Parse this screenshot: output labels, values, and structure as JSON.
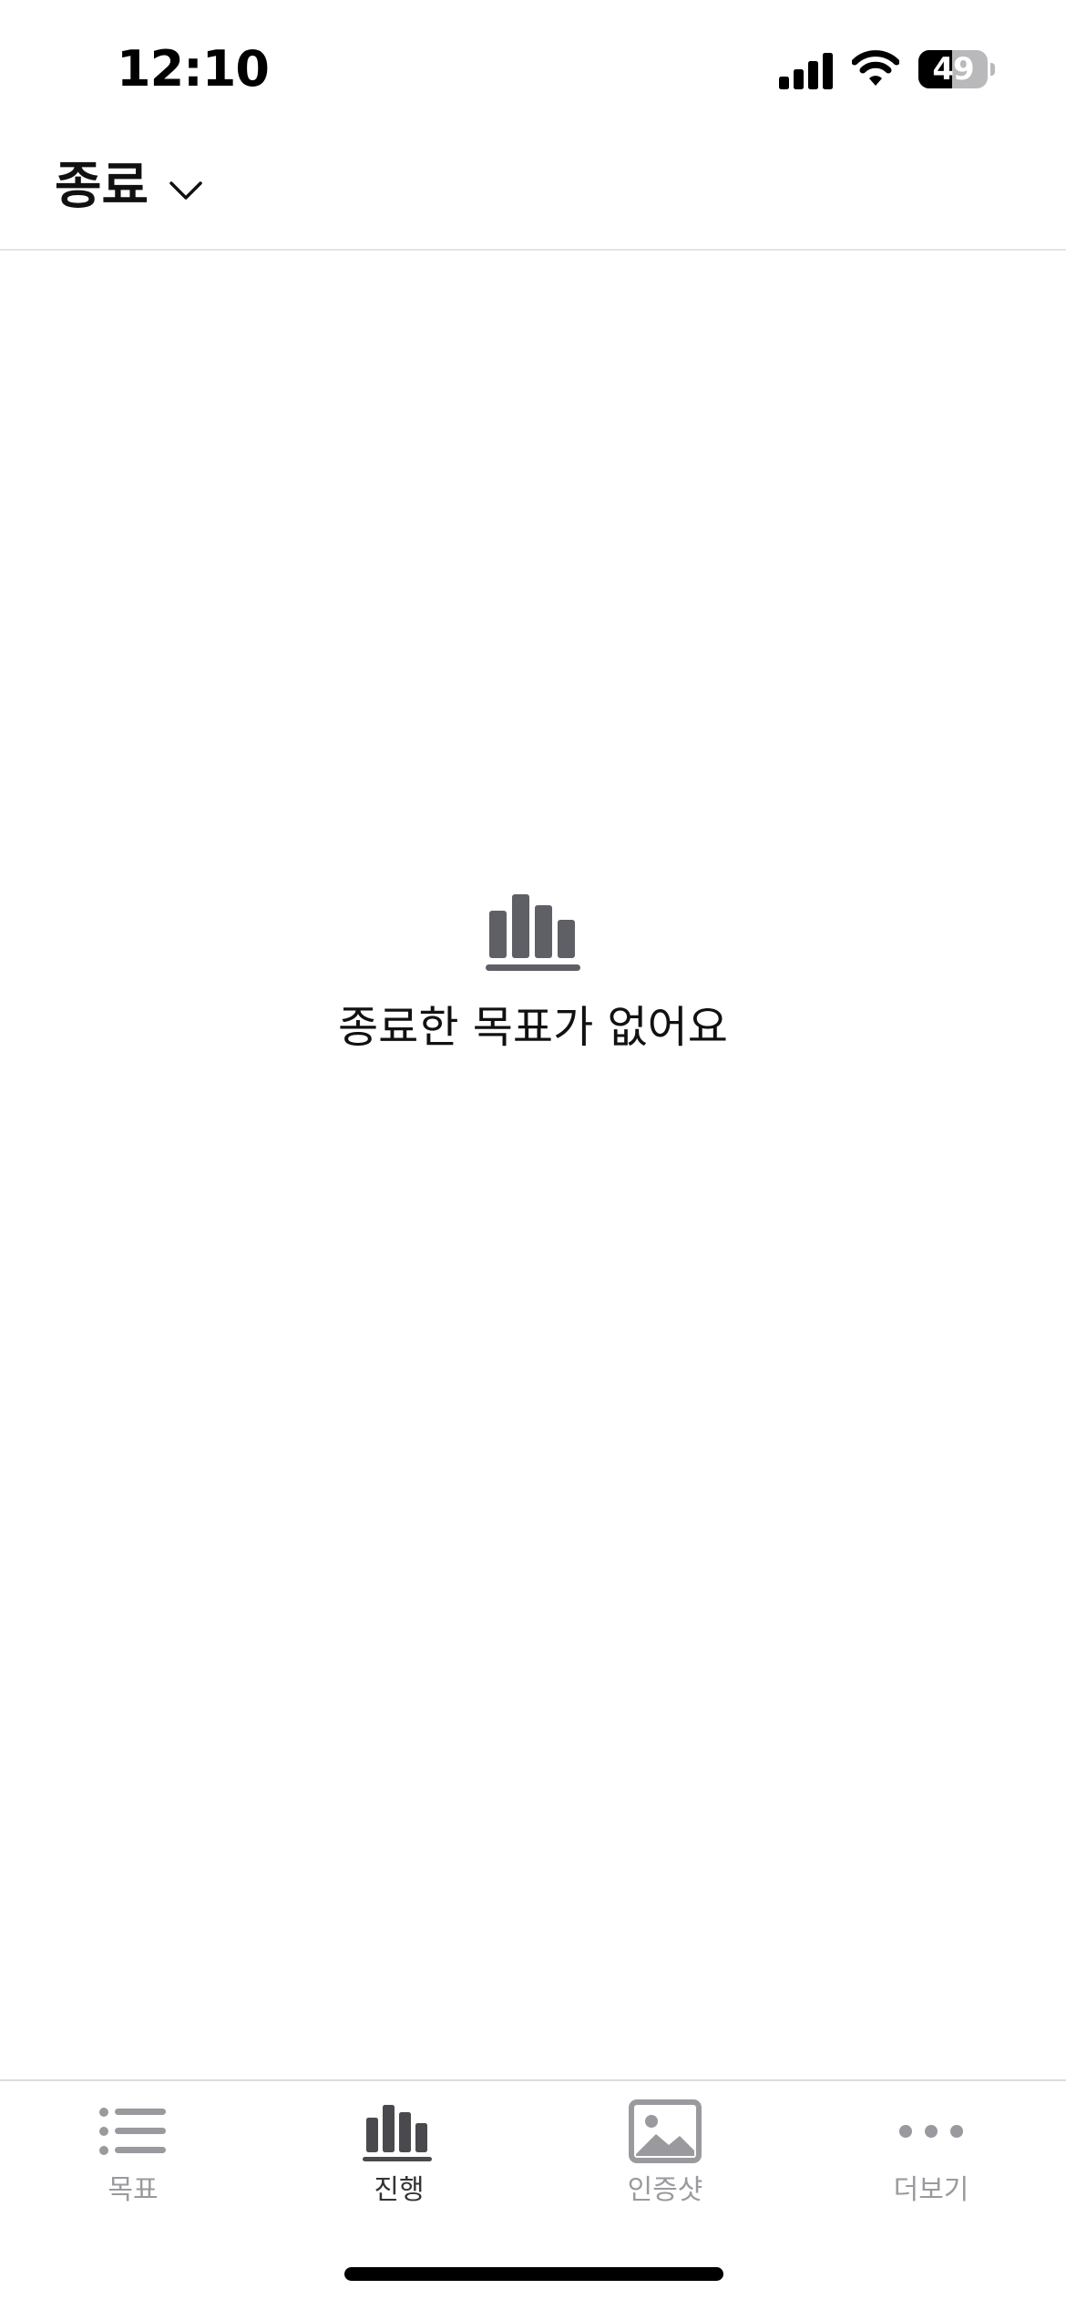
{
  "status_bar": {
    "time": "12:10",
    "battery_level": "49",
    "battery_fraction": 0.49
  },
  "header": {
    "filter_label": "종료",
    "filter_icon": "chevron-down-icon"
  },
  "empty_state": {
    "icon": "bar-chart-icon",
    "message": "종료한 목표가 없어요"
  },
  "tab_bar": {
    "active_tab": "진행",
    "tabs": [
      {
        "label": "목표",
        "icon": "list-icon"
      },
      {
        "label": "진행",
        "icon": "bar-chart-icon"
      },
      {
        "label": "인증샷",
        "icon": "photo-icon"
      },
      {
        "label": "더보기",
        "icon": "more-dots-icon"
      }
    ]
  },
  "colors": {
    "icon_active": "#4a4a4e",
    "icon_inactive": "#9a9a9e",
    "empty_icon": "#5f5f66",
    "divider": "#e4e4e6"
  }
}
